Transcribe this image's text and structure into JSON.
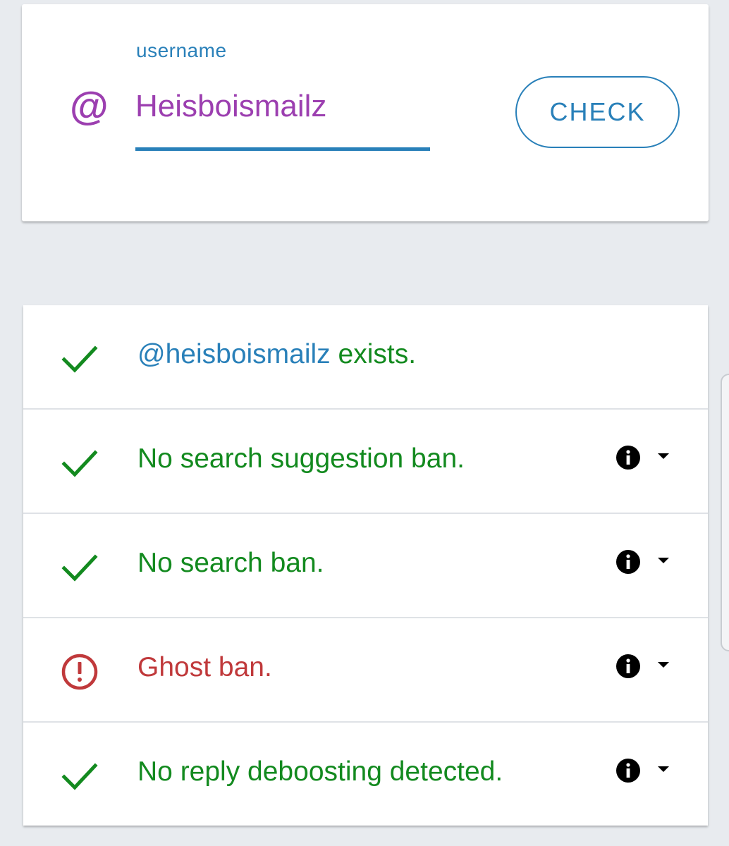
{
  "search": {
    "label": "username",
    "at_symbol": "@",
    "value": "Heisboismailz",
    "check_label": "CHECK"
  },
  "results": {
    "exists": {
      "handle": "@heisboismailz",
      "suffix": " exists.",
      "status": "ok",
      "icon": "check-icon"
    },
    "rows": [
      {
        "text": "No search suggestion ban.",
        "status": "ok",
        "icon": "check-icon"
      },
      {
        "text": "No search ban.",
        "status": "ok",
        "icon": "check-icon"
      },
      {
        "text": "Ghost ban.",
        "status": "bad",
        "icon": "alert-circle-icon"
      },
      {
        "text": "No reply deboosting detected.",
        "status": "ok",
        "icon": "check-icon"
      }
    ]
  },
  "colors": {
    "accent": "#2980b9",
    "username": "#9c3fb0",
    "ok": "#138a1f",
    "bad": "#c0393b",
    "background": "#e8ebef"
  }
}
